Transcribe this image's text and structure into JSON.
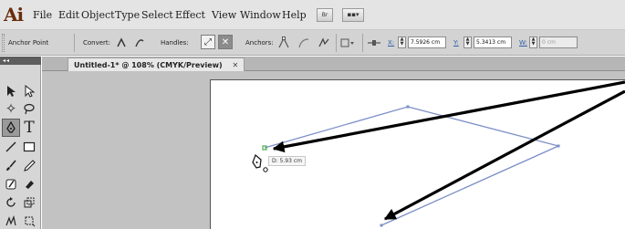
{
  "menubar": {
    "logo": "Ai",
    "items": [
      "File",
      "Edit",
      "Object",
      "Type",
      "Select",
      "Effect",
      "View",
      "Window",
      "Help"
    ],
    "bridge_label": "Br",
    "arrange_label": "▪▪▾"
  },
  "controlbar": {
    "anchor_point_label": "Anchor Point",
    "convert_label": "Convert:",
    "handles_label": "Handles:",
    "anchors_label": "Anchors:",
    "x_label": "X:",
    "x_value": "7.5926 cm",
    "y_label": "Y:",
    "y_value": "5.3413 cm",
    "w_label": "W:",
    "w_value": "0 cm"
  },
  "tools_panel": {
    "header": "◂◂",
    "tools": [
      "selection",
      "direct-selection",
      "magic-wand",
      "lasso",
      "pen",
      "type",
      "line-segment",
      "rectangle",
      "paintbrush",
      "pencil",
      "blob-brush",
      "eraser",
      "rotate",
      "scale",
      "warp",
      "free-transform"
    ]
  },
  "document": {
    "tab_title": "Untitled-1* @ 108% (CMYK/Preview)",
    "tab_close": "✕"
  },
  "canvas": {
    "distance_tooltip": "D: 5.93 cm",
    "path_color": "#7b8fc7",
    "annotation_arrow_color": "#000000",
    "active_anchor_color": "#4caf50"
  }
}
